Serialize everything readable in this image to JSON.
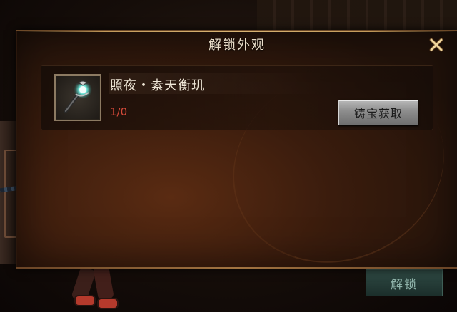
{
  "dialog": {
    "title": "解锁外观",
    "close_icon": "close-x-icon"
  },
  "item": {
    "name": "照夜・素天衡玑",
    "count": "1/0",
    "icon": "jade-staff-icon",
    "obtain_label": "铸宝获取"
  },
  "background": {
    "unlock_label": "解锁"
  },
  "colors": {
    "title_text": "#e8dcc8",
    "count_red": "#d64a3a",
    "close_gold": "#e8c98a",
    "panel_dark": "#21120a"
  }
}
